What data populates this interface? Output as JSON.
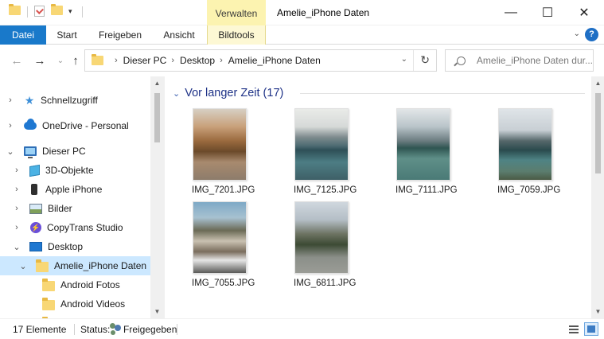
{
  "window": {
    "title": "Amelie_iPhone Daten",
    "context_tab_header": "Verwalten",
    "minimize_glyph": "—",
    "maximize_glyph": "☐",
    "close_glyph": "✕"
  },
  "ribbon": {
    "tabs": [
      "Datei",
      "Start",
      "Freigeben",
      "Ansicht",
      "Bildtools"
    ],
    "help_glyph": "?"
  },
  "address": {
    "breadcrumbs": [
      "Dieser PC",
      "Desktop",
      "Amelie_iPhone Daten"
    ],
    "search_placeholder": "Amelie_iPhone Daten dur..."
  },
  "sidebar": {
    "items": [
      {
        "label": "Schnellzugriff",
        "icon": "star-icon"
      },
      {
        "label": "OneDrive - Personal",
        "icon": "onedrive-icon"
      },
      {
        "label": "Dieser PC",
        "icon": "pc-icon"
      },
      {
        "label": "3D-Objekte",
        "icon": "3d-objects-icon"
      },
      {
        "label": "Apple iPhone",
        "icon": "iphone-icon"
      },
      {
        "label": "Bilder",
        "icon": "pictures-icon"
      },
      {
        "label": "CopyTrans Studio",
        "icon": "copytrans-icon"
      },
      {
        "label": "Desktop",
        "icon": "desktop-icon"
      },
      {
        "label": "Amelie_iPhone Daten",
        "icon": "folder-icon"
      },
      {
        "label": "Android Fotos",
        "icon": "folder-icon"
      },
      {
        "label": "Android Videos",
        "icon": "folder-icon"
      }
    ]
  },
  "content": {
    "group_header": "Vor langer Zeit (17)",
    "files": [
      {
        "name": "IMG_7201.JPG"
      },
      {
        "name": "IMG_7125.JPG"
      },
      {
        "name": "IMG_7111.JPG"
      },
      {
        "name": "IMG_7059.JPG"
      },
      {
        "name": "IMG_7055.JPG"
      },
      {
        "name": "IMG_6811.JPG"
      }
    ]
  },
  "statusbar": {
    "item_count": "17 Elemente",
    "status_label": "Status:",
    "status_value": "Freigegeben"
  },
  "colors": {
    "file_tab": "#1979ca",
    "context_tab": "#fcf3b0",
    "selection": "#cce8ff",
    "group_header": "#1e3287"
  }
}
